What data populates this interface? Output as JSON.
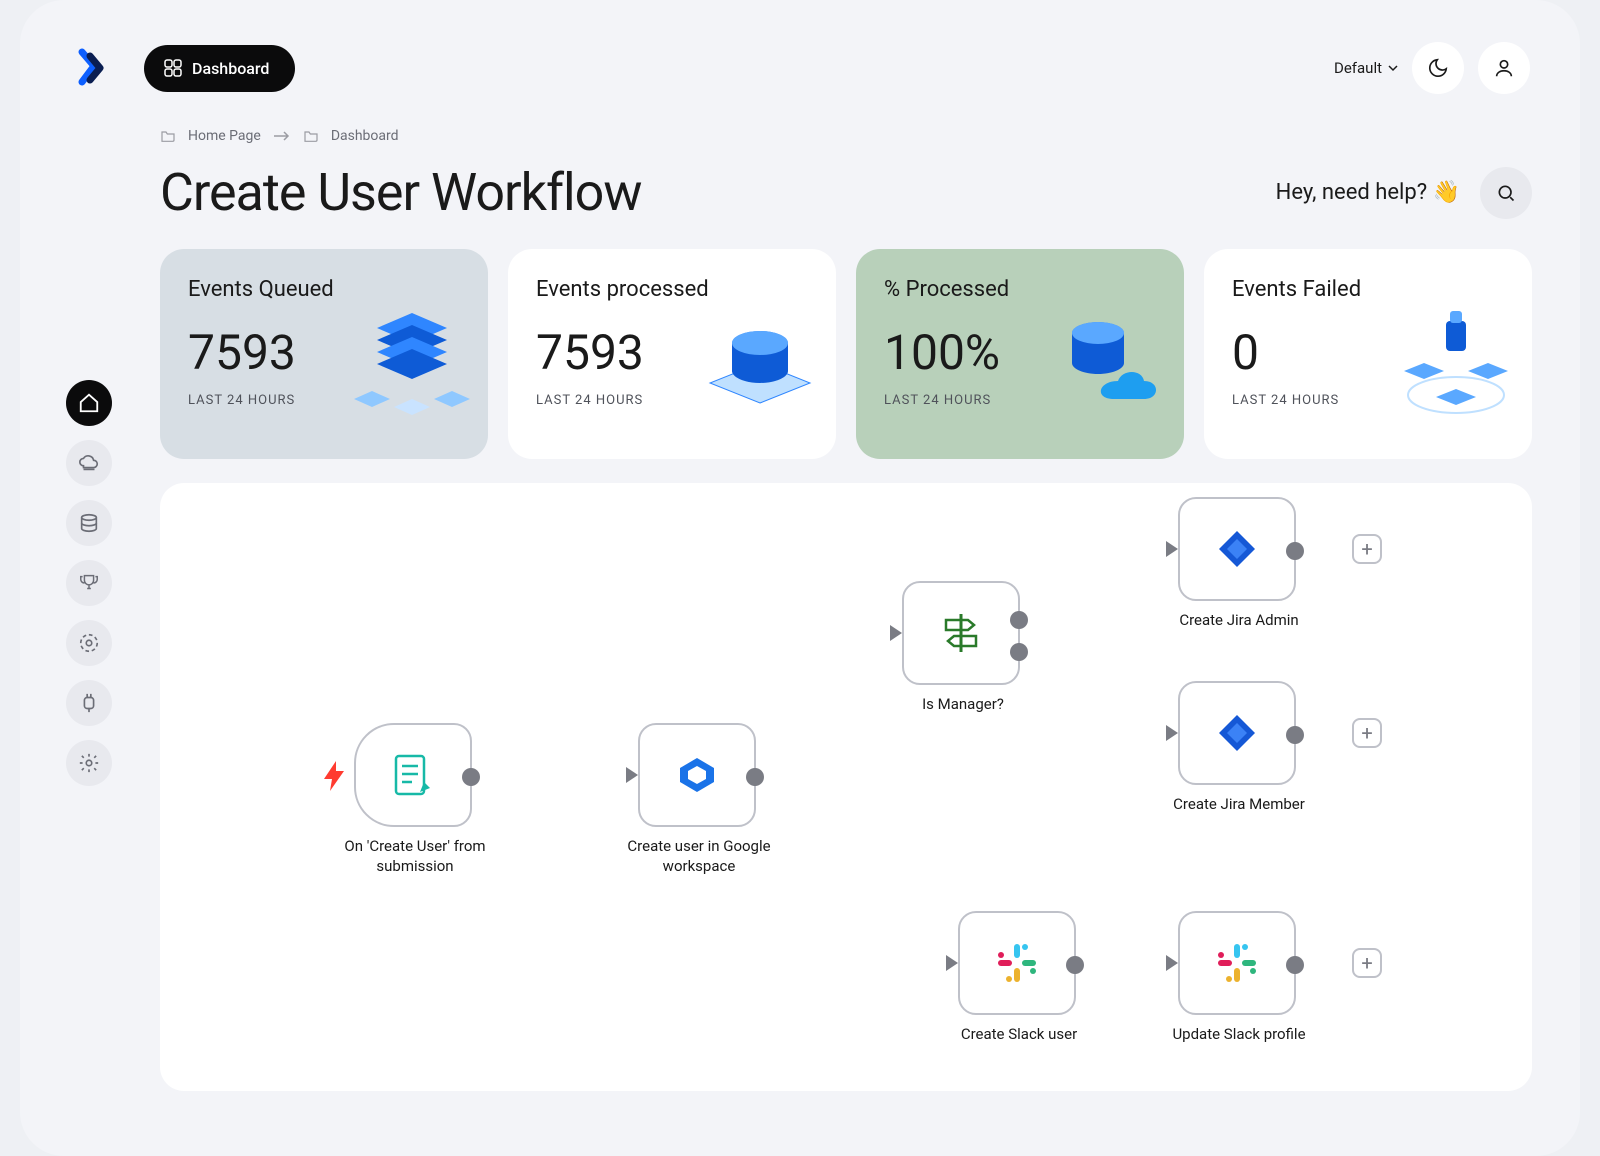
{
  "topbar": {
    "dashboard_label": "Dashboard",
    "theme_label": "Default"
  },
  "breadcrumb": {
    "items": [
      "Home Page",
      "Dashboard"
    ]
  },
  "page": {
    "title": "Create User Workflow",
    "help_text": "Hey, need help?",
    "help_emoji": "👋"
  },
  "cards": [
    {
      "title": "Events Queued",
      "value": "7593",
      "sub": "LAST 24 HOURS"
    },
    {
      "title": "Events processed",
      "value": "7593",
      "sub": "LAST 24 HOURS"
    },
    {
      "title": "% Processed",
      "value": "100%",
      "sub": "LAST 24 HOURS"
    },
    {
      "title": "Events Failed",
      "value": "0",
      "sub": "LAST 24 HOURS"
    }
  ],
  "workflow": {
    "nodes": {
      "n1": "On 'Create User' from submission",
      "n2": "Create user in Google workspace",
      "n3": "Is Manager?",
      "n4": "Create Jira Admin",
      "n5": "Create Jira Member",
      "n6": "Create Slack user",
      "n7": "Update Slack profile"
    }
  },
  "sidebar": {
    "items": [
      "home",
      "alerts",
      "data",
      "team",
      "automation",
      "integrations",
      "settings"
    ]
  }
}
